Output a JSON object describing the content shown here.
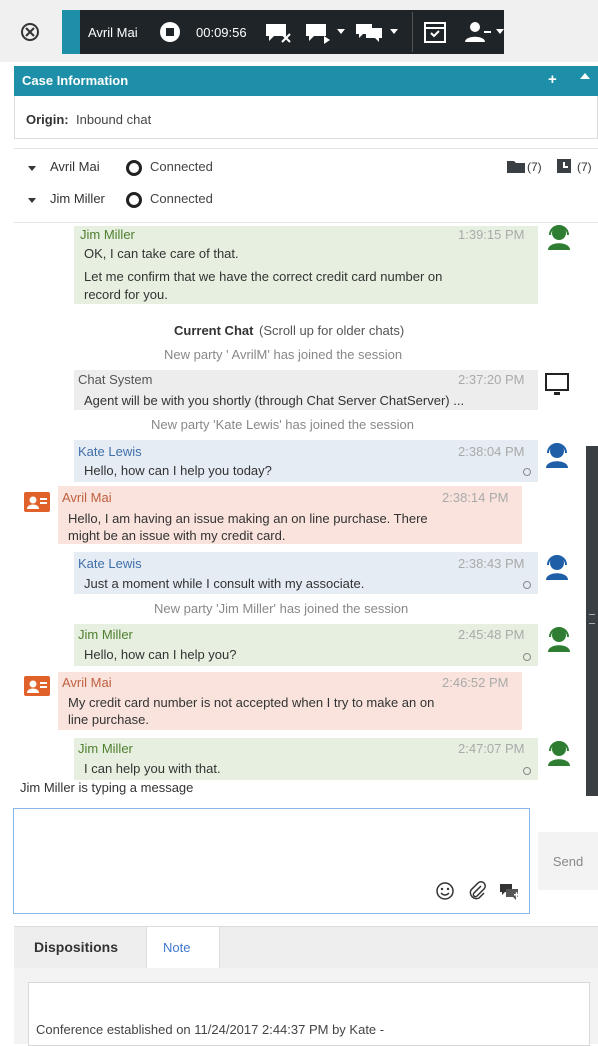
{
  "toolbar": {
    "contact_name": "Avril Mai",
    "timer": "00:09:56",
    "icons": [
      "close-circle-icon",
      "end-chat-icon",
      "transfer-chat-icon",
      "consult-chat-icon",
      "schedule-callback-icon",
      "party-action-icon"
    ]
  },
  "case_info": {
    "title": "Case Information",
    "origin_label": "Origin:",
    "origin_value": "Inbound chat"
  },
  "participants": [
    {
      "name": "Avril Mai",
      "status": "Connected"
    },
    {
      "name": "Jim Miller",
      "status": "Connected"
    }
  ],
  "counts": {
    "folder": "(7)",
    "history": "(7)"
  },
  "transcript": {
    "current_chat_bold": "Current Chat",
    "current_chat_rest": "(Scroll up for older chats)",
    "messages": [
      {
        "from": "Jim Miller",
        "time": "1:39:15 PM",
        "lines": [
          "OK, I can take care of that.",
          "Let me confirm that we have the correct credit card number on",
          "record for you."
        ]
      },
      {
        "from": "Chat System",
        "time": "2:37:20 PM",
        "text": "Agent will be with you shortly (through Chat Server ChatServer) ..."
      },
      {
        "from": "Kate Lewis",
        "time": "2:38:04 PM",
        "text": "Hello, how can I help you today?"
      },
      {
        "from": "Avril Mai",
        "time": "2:38:14 PM",
        "lines": [
          "Hello, I am having an issue making an on line purchase. There",
          "might be an issue with my credit card."
        ]
      },
      {
        "from": "Kate Lewis",
        "time": "2:38:43 PM",
        "text": "Just a moment while I consult with my associate."
      },
      {
        "from": "Jim Miller",
        "time": "2:45:48 PM",
        "text": "Hello, how can I help you?"
      },
      {
        "from": "Avril Mai",
        "time": "2:46:52 PM",
        "lines": [
          "My credit card number is not accepted when I try to make an on",
          "line purchase."
        ]
      },
      {
        "from": "Jim Miller",
        "time": "2:47:07 PM",
        "text": "I can help you with that."
      }
    ],
    "system": [
      "New party ' AvrilM' has joined the session",
      "New party 'Kate Lewis' has joined the session",
      "New party 'Jim Miller' has joined the session"
    ],
    "typing": "Jim Miller is typing a message"
  },
  "input": {
    "send_label": "Send",
    "icons": [
      "smiley-icon",
      "attachment-icon",
      "standard-response-icon"
    ]
  },
  "tabs": [
    "Dispositions",
    "Note"
  ],
  "note_text": "Conference established on 11/24/2017 2:44:37 PM by Kate -",
  "colors": {
    "accent": "#1e8fa8",
    "toolbar": "#1f2429",
    "agent_green": "#4f7f2f",
    "agent_blue": "#3f6fa8",
    "customer": "#c06040"
  }
}
